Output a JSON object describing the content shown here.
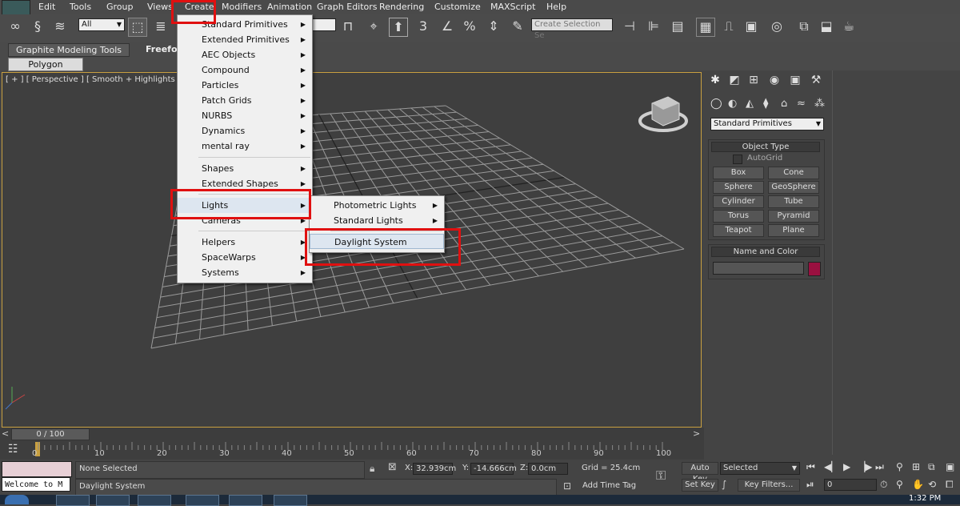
{
  "menubar": {
    "items": [
      "Edit",
      "Tools",
      "Group",
      "Views",
      "Create",
      "Modifiers",
      "Animation",
      "Graph Editors",
      "Rendering",
      "Customize",
      "MAXScript",
      "Help"
    ]
  },
  "toolbar": {
    "filter_value": "All",
    "selection_set_placeholder": "Create Selection Se",
    "snap_label": "3"
  },
  "ribbon": {
    "tabs": [
      "Graphite Modeling Tools",
      "Freeform"
    ],
    "subtab": "Polygon Modeling"
  },
  "viewport": {
    "label": "[ + ] [ Perspective ] [ Smooth + Highlights ]"
  },
  "create_menu": {
    "items": [
      "Standard Primitives",
      "Extended Primitives",
      "AEC Objects",
      "Compound",
      "Particles",
      "Patch Grids",
      "NURBS",
      "Dynamics",
      "mental ray",
      "Shapes",
      "Extended Shapes",
      "Lights",
      "Cameras",
      "Helpers",
      "SpaceWarps",
      "Systems"
    ]
  },
  "lights_submenu": {
    "items": [
      "Photometric Lights",
      "Standard Lights",
      "Daylight System"
    ]
  },
  "command_panel": {
    "category": "Standard Primitives",
    "object_type_title": "Object Type",
    "autogrid": "AutoGrid",
    "buttons": [
      "Box",
      "Cone",
      "Sphere",
      "GeoSphere",
      "Cylinder",
      "Tube",
      "Torus",
      "Pyramid",
      "Teapot",
      "Plane"
    ],
    "name_color_title": "Name and Color",
    "color": "#9a1040"
  },
  "timeline": {
    "frame": "0 / 100",
    "ticks": [
      "0",
      "10",
      "20",
      "30",
      "40",
      "50",
      "60",
      "70",
      "80",
      "90",
      "100"
    ]
  },
  "status": {
    "listener_text": "Welcome to M",
    "selection": "None Selected",
    "prompt": "Daylight System",
    "x_label": "X:",
    "x_value": "32.939cm",
    "y_label": "Y:",
    "y_value": "-14.666cm",
    "z_label": "Z:",
    "z_value": "0.0cm",
    "grid": "Grid = 25.4cm",
    "add_time_tag": "Add Time Tag",
    "auto_key": "Auto Key",
    "set_key": "Set Key",
    "selected": "Selected",
    "key_filters": "Key Filters...",
    "frame_field": "0"
  },
  "taskbar": {
    "clock": "1:32 PM"
  },
  "colors": {
    "highlight_red": "#e01010",
    "viewport_border": "#c9a040"
  }
}
